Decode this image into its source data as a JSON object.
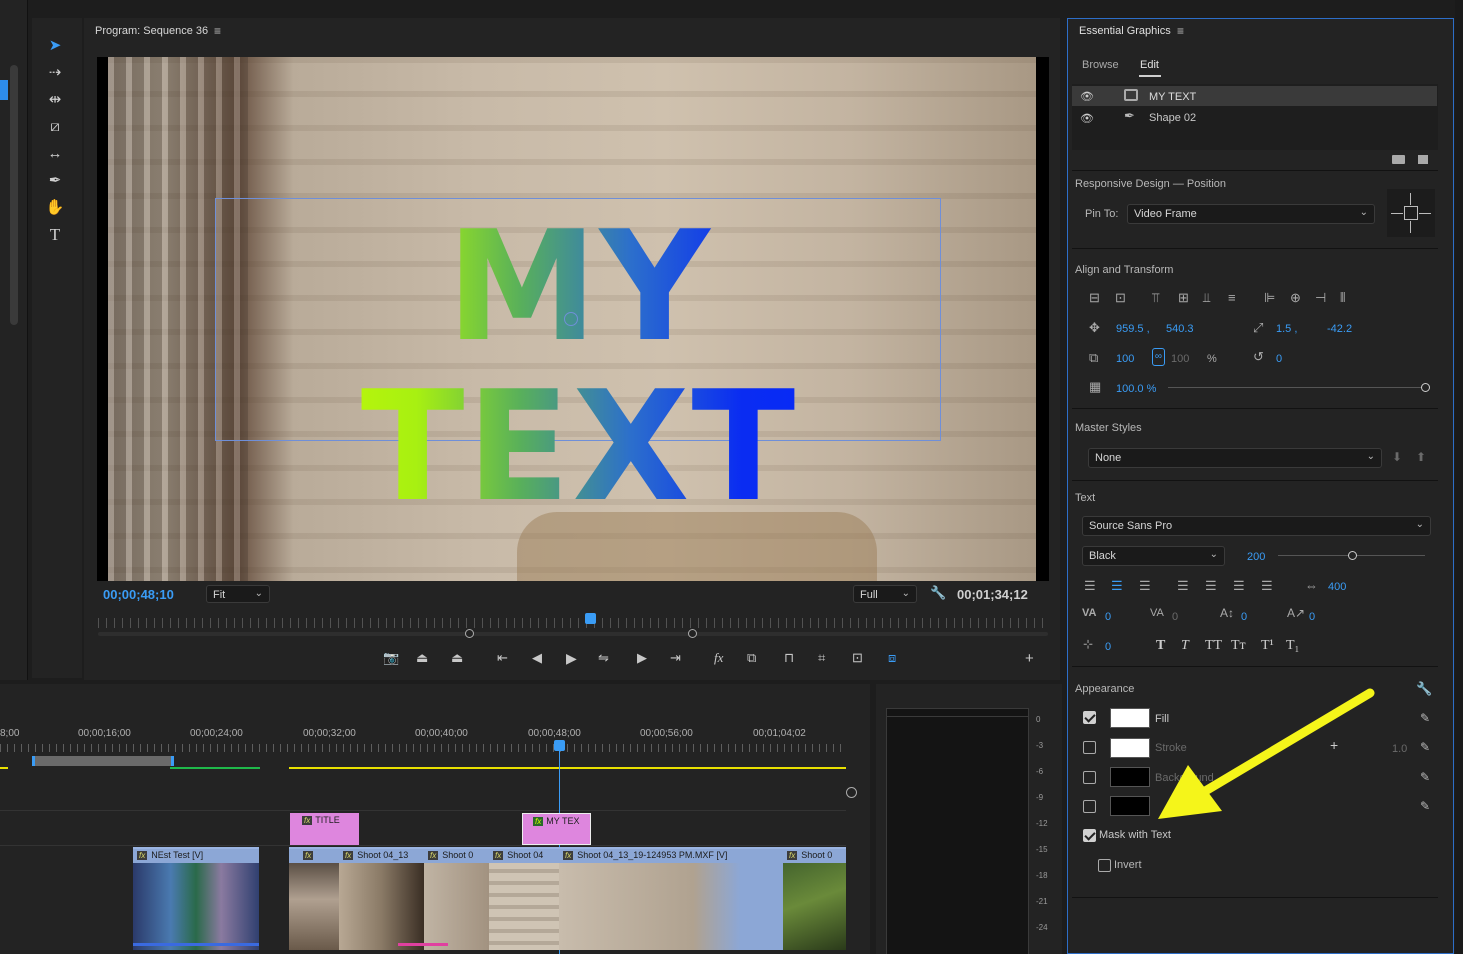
{
  "program_monitor": {
    "title": "Program: Sequence 36",
    "overlay_text": "MY TEXT",
    "timecode_current": "00;00;48;10",
    "zoom_select": "Fit",
    "resolution_select": "Full",
    "timecode_duration": "00;01;34;12"
  },
  "tools": [
    "selection-tool",
    "track-select-tool",
    "ripple-edit-tool",
    "razor-tool",
    "slip-tool",
    "pen-tool",
    "hand-tool",
    "type-tool"
  ],
  "essential_graphics": {
    "title": "Essential Graphics",
    "tabs": [
      "Browse",
      "Edit"
    ],
    "active_tab": "Edit",
    "layers": [
      {
        "name": "MY TEXT",
        "selected": true
      },
      {
        "name": "Shape 02",
        "selected": false
      }
    ],
    "responsive_design": {
      "title": "Responsive Design — Position",
      "pin_to_label": "Pin To:",
      "pin_to_value": "Video Frame"
    },
    "align_transform": {
      "title": "Align and Transform",
      "pos_x": "959.5 ,",
      "pos_y": "540.3",
      "anchor_x": "1.5 ,",
      "anchor_y": "-42.2",
      "scale_w": "100",
      "scale_h": "100",
      "scale_unit": "%",
      "rotation": "0",
      "opacity": "100.0 %"
    },
    "master_styles": {
      "title": "Master Styles",
      "value": "None"
    },
    "text": {
      "title": "Text",
      "font": "Source Sans Pro",
      "style": "Black",
      "size": "200",
      "size_slider_fraction": 0.38,
      "tracking_leading": "400",
      "kerning": "0",
      "tracking": "0",
      "baseline": "0",
      "tsume": "0",
      "leading": "0",
      "case_buttons": [
        "T",
        "T",
        "TT",
        "Tт",
        "T¹",
        "T₁"
      ]
    },
    "appearance": {
      "title": "Appearance",
      "fill_label": "Fill",
      "stroke_label": "Stroke",
      "stroke_width": "1.0",
      "background_label": "Background",
      "mask_label": "Mask with Text",
      "invert_label": "Invert",
      "fill_color": "#ffffff",
      "stroke_color": "#ffffff",
      "background_color": "#000000",
      "shadow_color": "#000000"
    }
  },
  "timeline": {
    "ruler": [
      "8;00",
      "00;00;16;00",
      "00;00;24;00",
      "00;00;32;00",
      "00;00;40;00",
      "00;00;48;00",
      "00;00;56;00",
      "00;01;04;02"
    ],
    "graphic_clips": [
      "TITLE",
      "MY TEX"
    ],
    "video_clips": [
      "NEst Test [V]",
      "Shoot 04_13",
      "Shoot 0",
      "Shoot 04",
      "Shoot 04_13_19-124953 PM.MXF [V]",
      "Shoot 0"
    ],
    "meter_scale": [
      "0",
      "-3",
      "-6",
      "-9",
      "-12",
      "-15",
      "-18",
      "-21",
      "-24"
    ]
  },
  "colors": {
    "accent": "#3a9cf5",
    "annotation_arrow": "#f5f51a",
    "graphic_clip": "#de86de",
    "video_clip": "#8ca7d6"
  }
}
